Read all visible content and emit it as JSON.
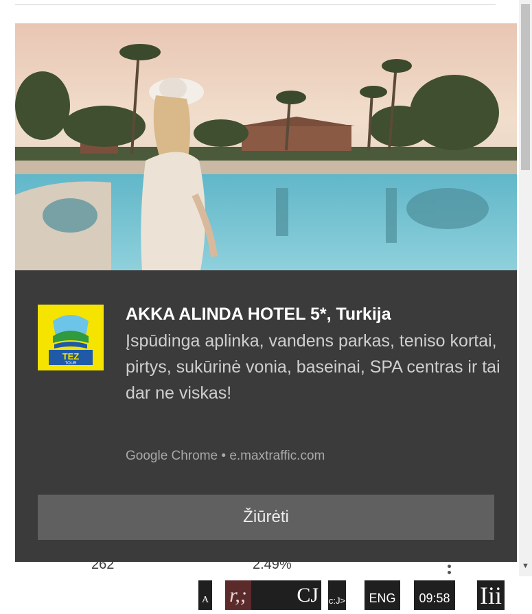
{
  "background": {
    "row": {
      "value_1": "262",
      "value_2": "2.49%"
    }
  },
  "notification": {
    "icon": "tez-tour-logo",
    "logo_text": "TEZ TOUR",
    "title": "AKKA ALINDA HOTEL 5*, Turkija",
    "body": "Įspūdinga aplinka, vandens parkas, teniso kortai, pirtys, sukūrinė vonia, baseinai, SPA centras ir tai dar ne viskas!",
    "source": "Google Chrome • e.maxtraffic.com",
    "action_label": "Žiūrėti"
  },
  "taskbar": {
    "item_a": "A",
    "item_r": "r,;",
    "item_cj": "CJ",
    "item_cj_small": "c:J>",
    "language": "ENG",
    "time": "09:58",
    "item_iii": "Iii"
  },
  "colors": {
    "toast_bg": "#3b3b3b",
    "button_bg": "#606060",
    "logo_yellow": "#f5e400",
    "logo_blue": "#1f5aa8"
  }
}
